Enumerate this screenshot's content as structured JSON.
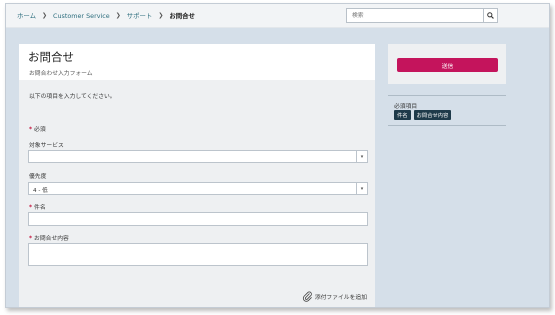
{
  "breadcrumb": {
    "items": [
      "ホーム",
      "Customer Service",
      "サポート"
    ],
    "current": "お問合せ"
  },
  "search": {
    "placeholder": "検索",
    "icon": "search-icon"
  },
  "form": {
    "title": "お問合せ",
    "subtitle": "お問合わせ入力フォーム",
    "intro": "以下の項目を入力してください。",
    "required_note": "必須",
    "fields": {
      "service": {
        "label": "対象サービス",
        "value": ""
      },
      "priority": {
        "label": "優先度",
        "value": "4 - 低"
      },
      "subject": {
        "label": "件名",
        "value": ""
      },
      "content": {
        "label": "お問合せ内容",
        "value": ""
      }
    },
    "attach_label": "添付ファイルを追加"
  },
  "sidebar": {
    "submit_label": "送信",
    "required_title": "必須項目",
    "required_tags": [
      "件名",
      "お問合せ内容"
    ]
  },
  "colors": {
    "accent": "#c4145c",
    "link": "#2d6e7e",
    "background": "#d5dfe9",
    "tag": "#1e3a4a"
  }
}
